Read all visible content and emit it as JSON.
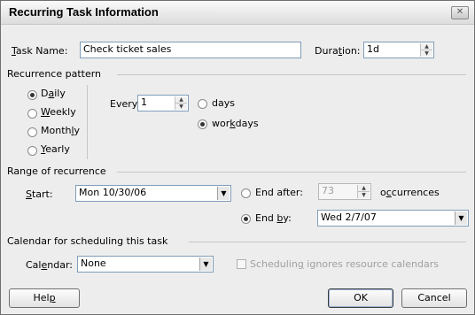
{
  "title": "Recurring Task Information",
  "task": {
    "name_label": "Task Name:",
    "name_value": "Check ticket sales",
    "duration_label": "Duration:",
    "duration_value": "1d"
  },
  "recurrence": {
    "heading": "Recurrence pattern",
    "patterns": [
      "Daily",
      "Weekly",
      "Monthly",
      "Yearly"
    ],
    "selected_pattern": "Daily",
    "every_label": "Every",
    "every_value": "1",
    "units": [
      "days",
      "workdays"
    ],
    "selected_unit": "workdays"
  },
  "range": {
    "heading": "Range of recurrence",
    "start_label": "Start:",
    "start_value": "Mon 10/30/06",
    "end_after_label": "End after:",
    "end_after_value": "73",
    "occurrences_label": "occurrences",
    "end_by_label": "End by:",
    "end_by_value": "Wed 2/7/07",
    "selected_end": "End by"
  },
  "calendar": {
    "heading": "Calendar for scheduling this task",
    "label": "Calendar:",
    "value": "None",
    "ignore_label": "Scheduling ignores resource calendars",
    "ignore_checked": false
  },
  "buttons": {
    "help": "Help",
    "ok": "OK",
    "cancel": "Cancel"
  },
  "icons": {
    "close": "close-icon",
    "dropdown": "chevron-down-icon",
    "spin": "spinner-arrows-icon"
  }
}
